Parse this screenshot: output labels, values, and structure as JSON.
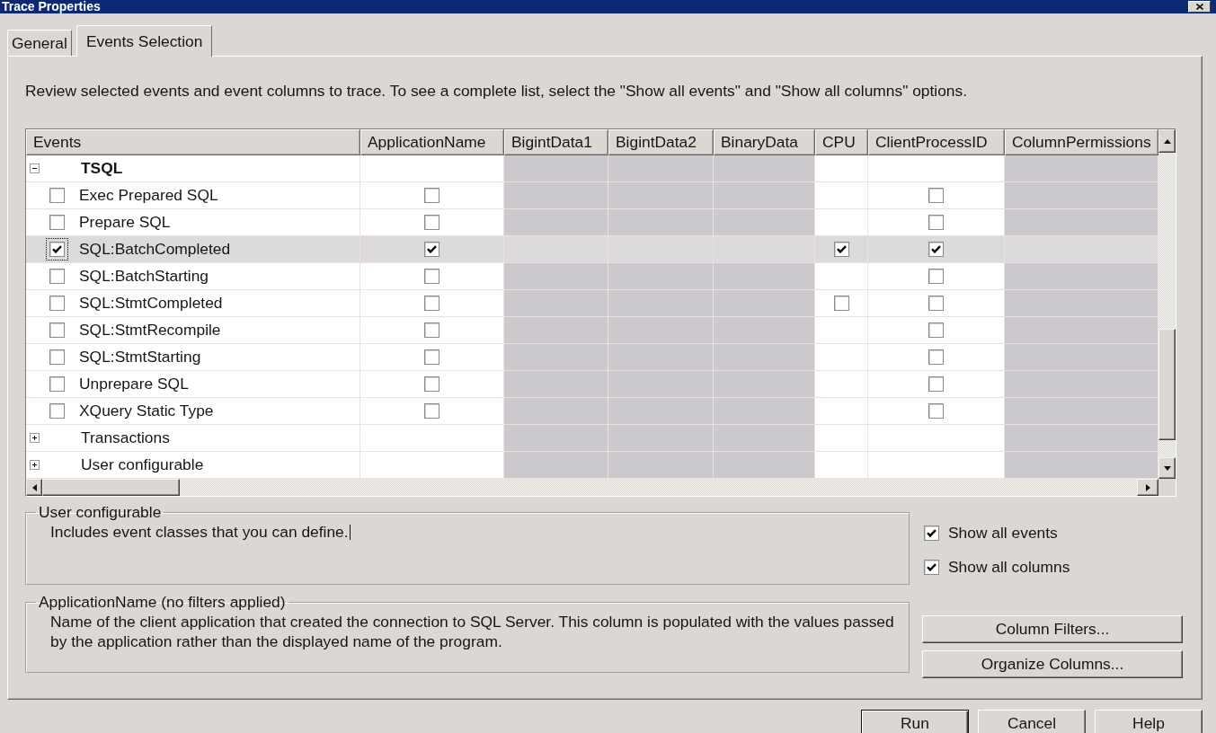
{
  "window": {
    "title": "Trace Properties"
  },
  "tabs": [
    {
      "label": "General",
      "selected": false
    },
    {
      "label": "Events Selection",
      "selected": true
    }
  ],
  "instructions": "Review selected events and event columns to trace. To see a complete list, select the \"Show all events\" and \"Show all columns\" options.",
  "grid": {
    "columns": [
      {
        "label": "Events",
        "available": true
      },
      {
        "label": "ApplicationName",
        "available": true
      },
      {
        "label": "BigintData1",
        "available": false
      },
      {
        "label": "BigintData2",
        "available": false
      },
      {
        "label": "BinaryData",
        "available": false
      },
      {
        "label": "CPU",
        "available": true
      },
      {
        "label": "ClientProcessID",
        "available": true
      },
      {
        "label": "ColumnPermissions",
        "available": false
      }
    ],
    "rows": [
      {
        "label": "TSQL",
        "expanded": true,
        "selected": false,
        "children": [
          {
            "label": "Exec Prepared SQL",
            "checked": false,
            "selected": false,
            "cells": [
              {
                "kind": "checkbox",
                "checked": false
              },
              {
                "kind": "empty"
              },
              {
                "kind": "empty"
              },
              {
                "kind": "empty"
              },
              {
                "kind": "empty"
              },
              {
                "kind": "checkbox",
                "checked": false
              },
              {
                "kind": "empty"
              }
            ]
          },
          {
            "label": "Prepare SQL",
            "checked": false,
            "selected": false,
            "cells": [
              {
                "kind": "checkbox",
                "checked": false
              },
              {
                "kind": "empty"
              },
              {
                "kind": "empty"
              },
              {
                "kind": "empty"
              },
              {
                "kind": "empty"
              },
              {
                "kind": "checkbox",
                "checked": false
              },
              {
                "kind": "empty"
              }
            ]
          },
          {
            "label": "SQL:BatchCompleted",
            "checked": true,
            "selected": true,
            "cells": [
              {
                "kind": "checkbox",
                "checked": true
              },
              {
                "kind": "empty"
              },
              {
                "kind": "empty"
              },
              {
                "kind": "empty"
              },
              {
                "kind": "checkbox",
                "checked": true
              },
              {
                "kind": "checkbox",
                "checked": true
              },
              {
                "kind": "empty"
              }
            ]
          },
          {
            "label": "SQL:BatchStarting",
            "checked": false,
            "selected": false,
            "cells": [
              {
                "kind": "checkbox",
                "checked": false
              },
              {
                "kind": "empty"
              },
              {
                "kind": "empty"
              },
              {
                "kind": "empty"
              },
              {
                "kind": "empty"
              },
              {
                "kind": "checkbox",
                "checked": false
              },
              {
                "kind": "empty"
              }
            ]
          },
          {
            "label": "SQL:StmtCompleted",
            "checked": false,
            "selected": false,
            "cells": [
              {
                "kind": "checkbox",
                "checked": false
              },
              {
                "kind": "empty"
              },
              {
                "kind": "empty"
              },
              {
                "kind": "empty"
              },
              {
                "kind": "checkbox",
                "checked": false
              },
              {
                "kind": "checkbox",
                "checked": false
              },
              {
                "kind": "empty"
              }
            ]
          },
          {
            "label": "SQL:StmtRecompile",
            "checked": false,
            "selected": false,
            "cells": [
              {
                "kind": "checkbox",
                "checked": false
              },
              {
                "kind": "empty"
              },
              {
                "kind": "empty"
              },
              {
                "kind": "empty"
              },
              {
                "kind": "empty"
              },
              {
                "kind": "checkbox",
                "checked": false
              },
              {
                "kind": "empty"
              }
            ]
          },
          {
            "label": "SQL:StmtStarting",
            "checked": false,
            "selected": false,
            "cells": [
              {
                "kind": "checkbox",
                "checked": false
              },
              {
                "kind": "empty"
              },
              {
                "kind": "empty"
              },
              {
                "kind": "empty"
              },
              {
                "kind": "empty"
              },
              {
                "kind": "checkbox",
                "checked": false
              },
              {
                "kind": "empty"
              }
            ]
          },
          {
            "label": "Unprepare SQL",
            "checked": false,
            "selected": false,
            "cells": [
              {
                "kind": "checkbox",
                "checked": false
              },
              {
                "kind": "empty"
              },
              {
                "kind": "empty"
              },
              {
                "kind": "empty"
              },
              {
                "kind": "empty"
              },
              {
                "kind": "checkbox",
                "checked": false
              },
              {
                "kind": "empty"
              }
            ]
          },
          {
            "label": "XQuery Static Type",
            "checked": false,
            "selected": false,
            "cells": [
              {
                "kind": "checkbox",
                "checked": false
              },
              {
                "kind": "empty"
              },
              {
                "kind": "empty"
              },
              {
                "kind": "empty"
              },
              {
                "kind": "empty"
              },
              {
                "kind": "checkbox",
                "checked": false
              },
              {
                "kind": "empty"
              }
            ]
          }
        ]
      },
      {
        "label": "Transactions",
        "expanded": false,
        "selected": false
      },
      {
        "label": "User configurable",
        "expanded": false,
        "selected": false
      }
    ]
  },
  "event_info": {
    "title": "User configurable",
    "text": "Includes event classes that you can define.",
    "focused": true
  },
  "column_info": {
    "title": "ApplicationName (no filters applied)",
    "text": "Name of the client application that created the connection to SQL Server. This column is populated with the values passed by the application rather than the displayed name of the program."
  },
  "options": [
    {
      "label": "Show all events",
      "checked": true
    },
    {
      "label": "Show all columns",
      "checked": true
    }
  ],
  "side_buttons": [
    {
      "label": "Column Filters..."
    },
    {
      "label": "Organize Columns..."
    }
  ],
  "footer_buttons": [
    {
      "label": "Run",
      "default": true
    },
    {
      "label": "Cancel",
      "default": false
    },
    {
      "label": "Help",
      "default": false
    }
  ]
}
